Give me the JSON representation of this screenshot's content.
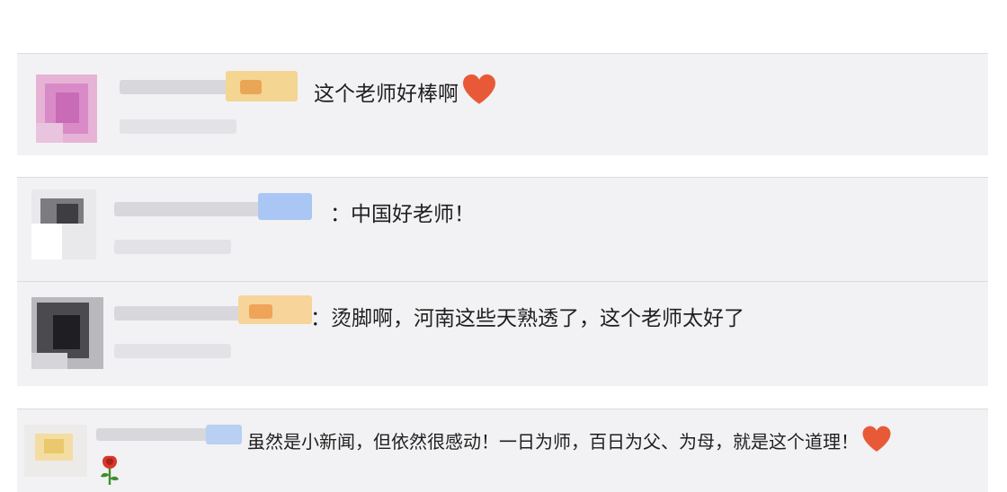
{
  "comments": [
    {
      "id": 1,
      "text": "这个老师好棒啊",
      "emoji": "heart-icon"
    },
    {
      "id": 2,
      "text": "：中国好老师！"
    },
    {
      "id": 3,
      "text": "：烫脚啊，河南这些天熟透了，这个老师太好了"
    },
    {
      "id": 4,
      "text": "虽然是小新闻，但依然很感动！一日为师，百日为父、为母，就是这个道理！",
      "emoji": [
        "heart-icon",
        "rose-icon"
      ]
    }
  ],
  "colors": {
    "card_bg": "#f2f2f4",
    "text": "#1f1f1f",
    "heart": "#e85a37"
  }
}
